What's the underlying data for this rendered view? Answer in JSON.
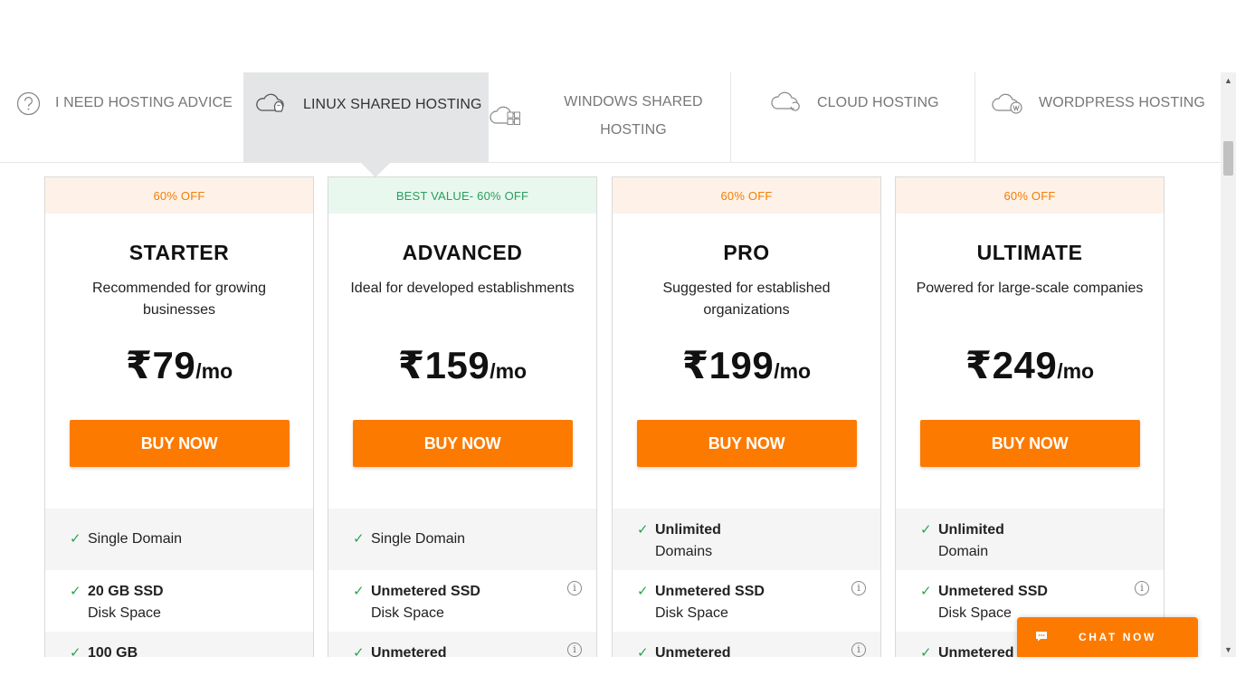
{
  "tabs": [
    {
      "label": "I NEED HOSTING ADVICE",
      "icon": "question-circle-icon"
    },
    {
      "label": "LINUX SHARED HOSTING",
      "icon": "cloud-linux-icon"
    },
    {
      "label": "WINDOWS SHARED HOSTING",
      "icon": "cloud-windows-icon"
    },
    {
      "label": "CLOUD HOSTING",
      "icon": "cloud-refresh-icon"
    },
    {
      "label": "WORDPRESS HOSTING",
      "icon": "cloud-wordpress-icon"
    }
  ],
  "colors": {
    "accent": "#fd7a00",
    "offText": "#f57c00",
    "bestText": "#2a9d5c",
    "check": "#2da44e"
  },
  "plans": [
    {
      "badge": "60% OFF",
      "name": "STARTER",
      "desc": "Recommended for growing businesses",
      "price": "₹79",
      "per": "/mo",
      "buy": "BUY NOW",
      "features": [
        {
          "line1": "Single Domain",
          "line2": ""
        },
        {
          "line1": "20 GB SSD",
          "line2": "Disk Space"
        },
        {
          "line1": "100 GB",
          "line2": ""
        }
      ]
    },
    {
      "badge": "BEST VALUE- 60% OFF",
      "name": "ADVANCED",
      "desc": "Ideal for developed establishments",
      "price": "₹159",
      "per": "/mo",
      "buy": "BUY NOW",
      "features": [
        {
          "line1": "Single Domain",
          "line2": ""
        },
        {
          "line1": "Unmetered SSD",
          "line2": "Disk Space"
        },
        {
          "line1": "Unmetered",
          "line2": ""
        }
      ]
    },
    {
      "badge": "60% OFF",
      "name": "PRO",
      "desc": "Suggested for established organizations",
      "price": "₹199",
      "per": "/mo",
      "buy": "BUY NOW",
      "features": [
        {
          "line1": "Unlimited",
          "line2": "Domains"
        },
        {
          "line1": "Unmetered SSD",
          "line2": "Disk Space"
        },
        {
          "line1": "Unmetered",
          "line2": ""
        }
      ]
    },
    {
      "badge": "60% OFF",
      "name": "ULTIMATE",
      "desc": "Powered for large-scale companies",
      "price": "₹249",
      "per": "/mo",
      "buy": "BUY NOW",
      "features": [
        {
          "line1": "Unlimited",
          "line2": "Domain"
        },
        {
          "line1": "Unmetered SSD",
          "line2": "Disk Space"
        },
        {
          "line1": "Unmetered",
          "line2": ""
        }
      ]
    }
  ],
  "info_glyph": "i",
  "check_glyph": "✓",
  "chat": {
    "label": "CHAT NOW",
    "icon": "chat-bubble-icon"
  }
}
